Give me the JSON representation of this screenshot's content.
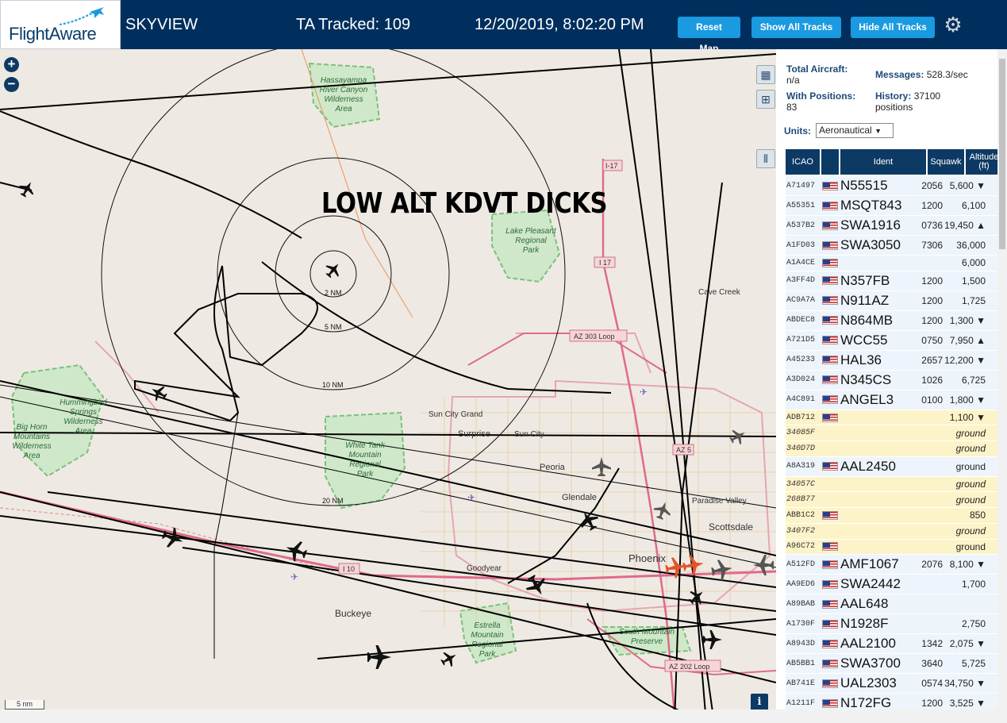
{
  "header": {
    "logo_text": "FlightAware",
    "app_name": "SKYVIEW",
    "tracked": "TA Tracked: 109",
    "datetime": "12/20/2019, 8:02:20 PM",
    "reset_label": "Reset Map",
    "show_label": "Show All Tracks",
    "hide_label": "Hide All Tracks"
  },
  "map": {
    "overlay_title": "LOW ALT KDVT DICKS",
    "scale_label": "5 nm",
    "info_label": "i",
    "range_labels": [
      "2 NM",
      "5 NM",
      "10 NM",
      "20 NM"
    ],
    "places": [
      "Hassayampa River Canyon Wilderness Area",
      "Hummingbird Springs Wilderness Area",
      "Big Horn Mountains Wilderness Area",
      "Lake Pleasant Regional Park",
      "White Tank Mountain Regional Park",
      "Estrella Mountain Regional Park",
      "South Mountain Preserve",
      "Sun City Grand",
      "Surprise",
      "Sun City",
      "Peoria",
      "Glendale",
      "Paradise Valley",
      "Scottsdale",
      "Phoenix",
      "Goodyear",
      "Buckeye",
      "Cave Creek"
    ],
    "road_labels": [
      "I-17",
      "I 17",
      "AZ 303 Loop",
      "I 10",
      "AZ 202 Loop",
      "AZ 5"
    ]
  },
  "stats": {
    "total_label": "Total Aircraft:",
    "total_value": "n/a",
    "messages_label": "Messages:",
    "messages_value": "528.3/sec",
    "positions_label": "With Positions:",
    "positions_value": "83",
    "history_label": "History:",
    "history_value": "37100 positions",
    "units_label": "Units:",
    "units_value": "Aeronautical"
  },
  "table": {
    "headers": [
      "ICAO",
      "Ident",
      "Squawk",
      "Altitude (ft)"
    ],
    "rows": [
      {
        "icao": "A71497",
        "ident": "N55515",
        "squawk": "2056",
        "alt": "5,600 ▼",
        "flag": true,
        "style": "normal"
      },
      {
        "icao": "A55351",
        "ident": "MSQT843",
        "squawk": "1200",
        "alt": "6,100",
        "flag": true,
        "style": "normal"
      },
      {
        "icao": "A537B2",
        "ident": "SWA1916",
        "squawk": "0736",
        "alt": "19,450 ▲",
        "flag": true,
        "style": "normal"
      },
      {
        "icao": "A1FD03",
        "ident": "SWA3050",
        "squawk": "7306",
        "alt": "36,000",
        "flag": true,
        "style": "normal"
      },
      {
        "icao": "A1A4CE",
        "ident": "",
        "squawk": "",
        "alt": "6,000",
        "flag": true,
        "style": "short"
      },
      {
        "icao": "A3FF4D",
        "ident": "N357FB",
        "squawk": "1200",
        "alt": "1,500",
        "flag": true,
        "style": "normal"
      },
      {
        "icao": "AC9A7A",
        "ident": "N911AZ",
        "squawk": "1200",
        "alt": "1,725",
        "flag": true,
        "style": "normal"
      },
      {
        "icao": "ABDEC8",
        "ident": "N864MB",
        "squawk": "1200",
        "alt": "1,300 ▼",
        "flag": true,
        "style": "normal"
      },
      {
        "icao": "A721D5",
        "ident": "WCC55",
        "squawk": "0750",
        "alt": "7,950 ▲",
        "flag": true,
        "style": "normal"
      },
      {
        "icao": "A45233",
        "ident": "HAL36",
        "squawk": "2657",
        "alt": "12,200 ▼",
        "flag": true,
        "style": "normal"
      },
      {
        "icao": "A3D024",
        "ident": "N345CS",
        "squawk": "1026",
        "alt": "6,725",
        "flag": true,
        "style": "normal"
      },
      {
        "icao": "A4C891",
        "ident": "ANGEL3",
        "squawk": "0100",
        "alt": "1,800 ▼",
        "flag": true,
        "style": "normal"
      },
      {
        "icao": "ADB712",
        "ident": "",
        "squawk": "",
        "alt": "1,100 ▼",
        "flag": true,
        "style": "yellow-short"
      },
      {
        "icao": "34085F",
        "ident": "",
        "squawk": "",
        "alt": "ground",
        "flag": false,
        "style": "yellow-short-it"
      },
      {
        "icao": "340D7D",
        "ident": "",
        "squawk": "",
        "alt": "ground",
        "flag": false,
        "style": "yellow-short-it"
      },
      {
        "icao": "A8A319",
        "ident": "AAL2450",
        "squawk": "",
        "alt": "ground",
        "flag": true,
        "style": "normal"
      },
      {
        "icao": "34057C",
        "ident": "",
        "squawk": "",
        "alt": "ground",
        "flag": false,
        "style": "yellow-short-it"
      },
      {
        "icao": "268B77",
        "ident": "",
        "squawk": "",
        "alt": "ground",
        "flag": false,
        "style": "yellow-short-it"
      },
      {
        "icao": "ABB1C2",
        "ident": "",
        "squawk": "",
        "alt": "850",
        "flag": true,
        "style": "yellow-short"
      },
      {
        "icao": "3407F2",
        "ident": "",
        "squawk": "",
        "alt": "ground",
        "flag": false,
        "style": "yellow-short-it"
      },
      {
        "icao": "A96C72",
        "ident": "",
        "squawk": "",
        "alt": "ground",
        "flag": true,
        "style": "yellow-short"
      },
      {
        "icao": "A512FD",
        "ident": "AMF1067",
        "squawk": "2076",
        "alt": "8,100 ▼",
        "flag": true,
        "style": "normal"
      },
      {
        "icao": "AA9ED6",
        "ident": "SWA2442",
        "squawk": "",
        "alt": "1,700",
        "flag": true,
        "style": "normal"
      },
      {
        "icao": "A89BAB",
        "ident": "AAL648",
        "squawk": "",
        "alt": "",
        "flag": true,
        "style": "normal"
      },
      {
        "icao": "A1730F",
        "ident": "N1928F",
        "squawk": "",
        "alt": "2,750",
        "flag": true,
        "style": "normal"
      },
      {
        "icao": "A8943D",
        "ident": "AAL2100",
        "squawk": "1342",
        "alt": "2,075 ▼",
        "flag": true,
        "style": "normal"
      },
      {
        "icao": "AB5BB1",
        "ident": "SWA3700",
        "squawk": "3640",
        "alt": "5,725",
        "flag": true,
        "style": "normal"
      },
      {
        "icao": "AB741E",
        "ident": "UAL2303",
        "squawk": "0574",
        "alt": "34,750 ▼",
        "flag": true,
        "style": "normal"
      },
      {
        "icao": "A1211F",
        "ident": "N172FG",
        "squawk": "1200",
        "alt": "3,525 ▼",
        "flag": true,
        "style": "normal"
      }
    ]
  },
  "colors": {
    "header_bg": "#002f5d",
    "button_bg": "#1a9ae0",
    "table_head": "#0d3a64",
    "map_bg": "#eeeae3",
    "city_pink": "#e6a5b3",
    "park_green": "#7cc07c"
  }
}
